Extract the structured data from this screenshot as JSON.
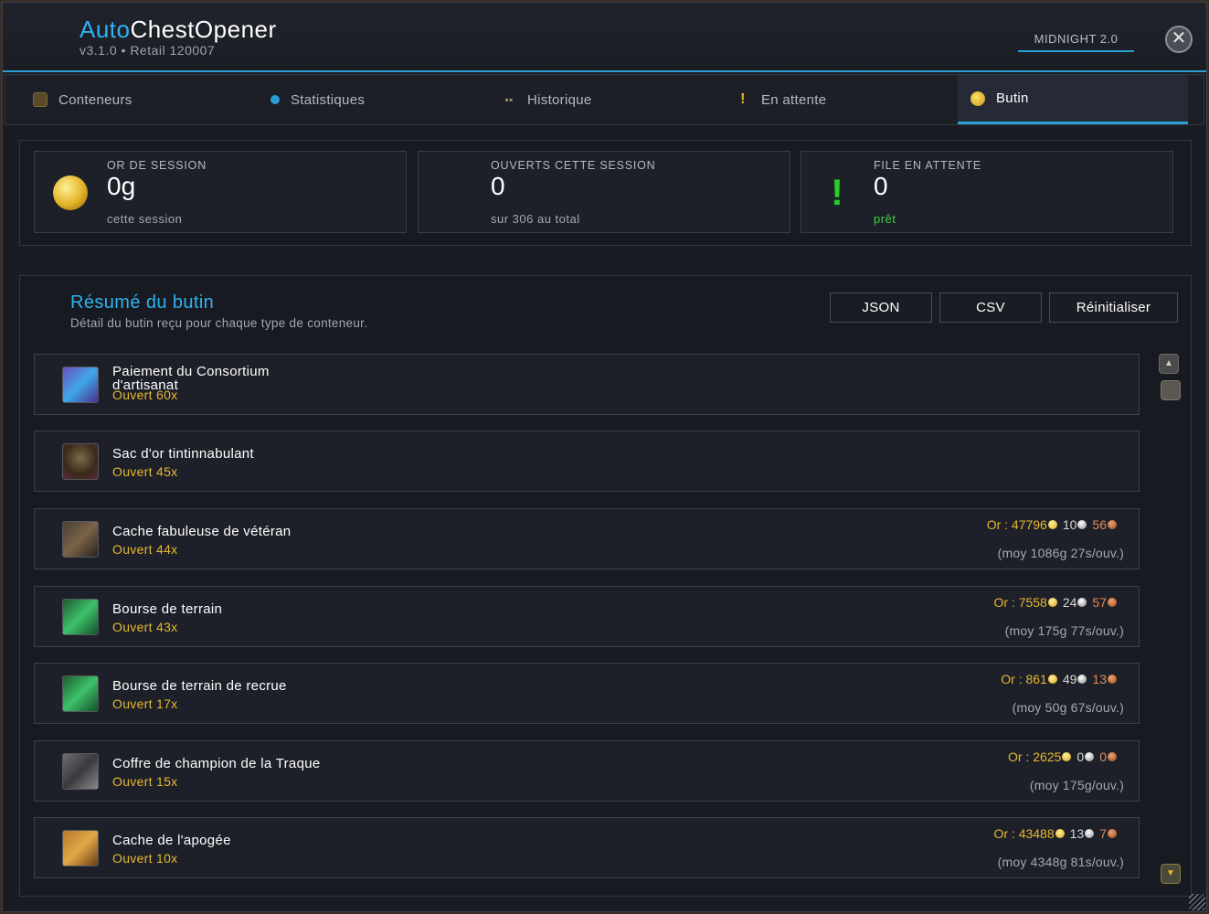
{
  "app": {
    "title_accent": "Auto",
    "title_main": "ChestOpener",
    "version": "v3.1.0  •  Retail 120007",
    "badge": "MIDNIGHT 2.0",
    "close_icon": "close-icon"
  },
  "tabs": [
    {
      "label": "Conteneurs",
      "icon": "chest-icon"
    },
    {
      "label": "Statistiques",
      "icon": "stats-icon"
    },
    {
      "label": "Historique",
      "icon": "book-icon"
    },
    {
      "label": "En attente",
      "icon": "exclamation-icon"
    },
    {
      "label": "Butin",
      "icon": "coins-icon",
      "active": true
    }
  ],
  "stats": {
    "gold": {
      "label": "OR DE SESSION",
      "value": "0g",
      "sub": "cette session",
      "icon": "gold-coin-icon"
    },
    "opened": {
      "label": "OUVERTS CETTE SESSION",
      "value": "0",
      "sub": "sur 306 au total"
    },
    "queue": {
      "label": "FILE EN ATTENTE",
      "value": "0",
      "sub": "prêt",
      "icon": "exclamation-icon",
      "sub_color": "#37d13a"
    }
  },
  "loot": {
    "title": "Résumé du butin",
    "description": "Détail du butin reçu pour chaque type de conteneur.",
    "buttons": {
      "json": "JSON",
      "csv": "CSV",
      "reset": "Réinitialiser"
    },
    "items": [
      {
        "name_line1": "Paiement du Consortium",
        "name_line2": "d'artisanat",
        "opened": "Ouvert 60x",
        "icon": "craft-payment-icon"
      },
      {
        "name_line1": "Sac d'or tintinnabulant",
        "opened": "Ouvert 45x",
        "icon": "gold-bag-icon"
      },
      {
        "name_line1": "Cache fabuleuse de vétéran",
        "opened": "Ouvert 44x",
        "icon": "veteran-cache-icon",
        "gold_label": "Or : 47796",
        "silver": "10",
        "copper": "56",
        "avg": "(moy 1086g 27s/ouv.)"
      },
      {
        "name_line1": "Bourse de terrain",
        "opened": "Ouvert 43x",
        "icon": "field-purse-icon",
        "gold_label": "Or : 7558",
        "silver": "24",
        "copper": "57",
        "avg": "(moy 175g 77s/ouv.)"
      },
      {
        "name_line1": "Bourse de terrain de recrue",
        "opened": "Ouvert 17x",
        "icon": "recruit-purse-icon",
        "gold_label": "Or : 861",
        "silver": "49",
        "copper": "13",
        "avg": "(moy 50g 67s/ouv.)"
      },
      {
        "name_line1": "Coffre de champion de la Traque",
        "opened": "Ouvert 15x",
        "icon": "champion-chest-icon",
        "gold_label": "Or : 2625",
        "silver": "0",
        "copper": "0",
        "avg": "(moy 175g/ouv.)"
      },
      {
        "name_line1": "Cache de l'apogée",
        "opened": "Ouvert 10x",
        "icon": "apogee-cache-icon",
        "gold_label": "Or : 43488",
        "silver": "13",
        "copper": "7",
        "avg": "(moy 4348g 81s/ouv.)"
      }
    ]
  },
  "colors": {
    "accent": "#2fb2ef",
    "gold": "#e5b82e",
    "green": "#37d13a"
  }
}
